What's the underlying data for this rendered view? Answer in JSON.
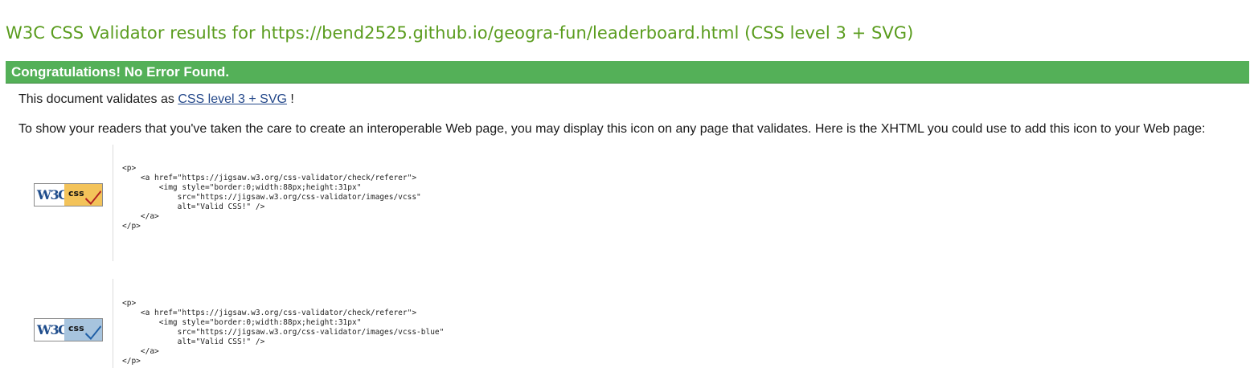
{
  "page": {
    "title": "W3C CSS Validator results for https://bend2525.github.io/geogra-fun/leaderboard.html (CSS level 3 + SVG)"
  },
  "banner": {
    "message": "Congratulations! No Error Found.",
    "color": "#54b058"
  },
  "validates": {
    "prefix": "This document validates as",
    "link_label": "CSS level 3 + SVG",
    "suffix": "!"
  },
  "instructions": {
    "text": "To show your readers that you've taken the care to create an interoperable Web page, you may display this icon on any page that validates. Here is the XHTML you could use to add this icon to your Web page:"
  },
  "badges": [
    {
      "variant": "gold",
      "logo_text": "W3C",
      "css_text": "css",
      "check_color": "#b22222",
      "code": "<p>\n    <a href=\"https://jigsaw.w3.org/css-validator/check/referer\">\n        <img style=\"border:0;width:88px;height:31px\"\n            src=\"https://jigsaw.w3.org/css-validator/images/vcss\"\n            alt=\"Valid CSS!\" />\n    </a>\n</p>"
    },
    {
      "variant": "blue",
      "logo_text": "W3C",
      "css_text": "css",
      "check_color": "#1f5fa6",
      "code": "<p>\n    <a href=\"https://jigsaw.w3.org/css-validator/check/referer\">\n        <img style=\"border:0;width:88px;height:31px\"\n            src=\"https://jigsaw.w3.org/css-validator/images/vcss-blue\"\n            alt=\"Valid CSS!\" />\n    </a>\n</p>"
    }
  ],
  "colors": {
    "title": "#5a9c1e",
    "link": "#24488a"
  }
}
